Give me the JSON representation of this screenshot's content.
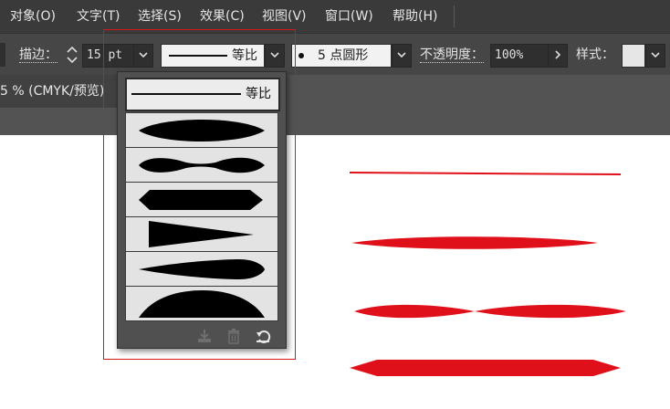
{
  "menu": {
    "items": [
      "对象(O)",
      "文字(T)",
      "选择(S)",
      "效果(C)",
      "视图(V)",
      "窗口(W)",
      "帮助(H)"
    ]
  },
  "control_bar": {
    "stroke_label": "描边：",
    "stroke_weight": "15 pt",
    "profile_label": "等比",
    "brush_value": "5 点圆形",
    "opacity_label": "不透明度：",
    "opacity_value": "100%",
    "style_label": "样式："
  },
  "document": {
    "tab_title": "5 % (CMYK/预览)"
  },
  "profile_popup": {
    "selected_label": "等比",
    "profiles": [
      "width-profile-1",
      "width-profile-2",
      "width-profile-3",
      "width-profile-4",
      "width-profile-5",
      "width-profile-6"
    ],
    "footer_icons": [
      "save-profile-icon",
      "delete-profile-icon",
      "reset-profile-icon"
    ]
  },
  "colors": {
    "stroke_red": "#e0101a",
    "menu_bg": "#3a3a3a",
    "control_bg": "#464646",
    "highlight_box": "#d81818"
  }
}
